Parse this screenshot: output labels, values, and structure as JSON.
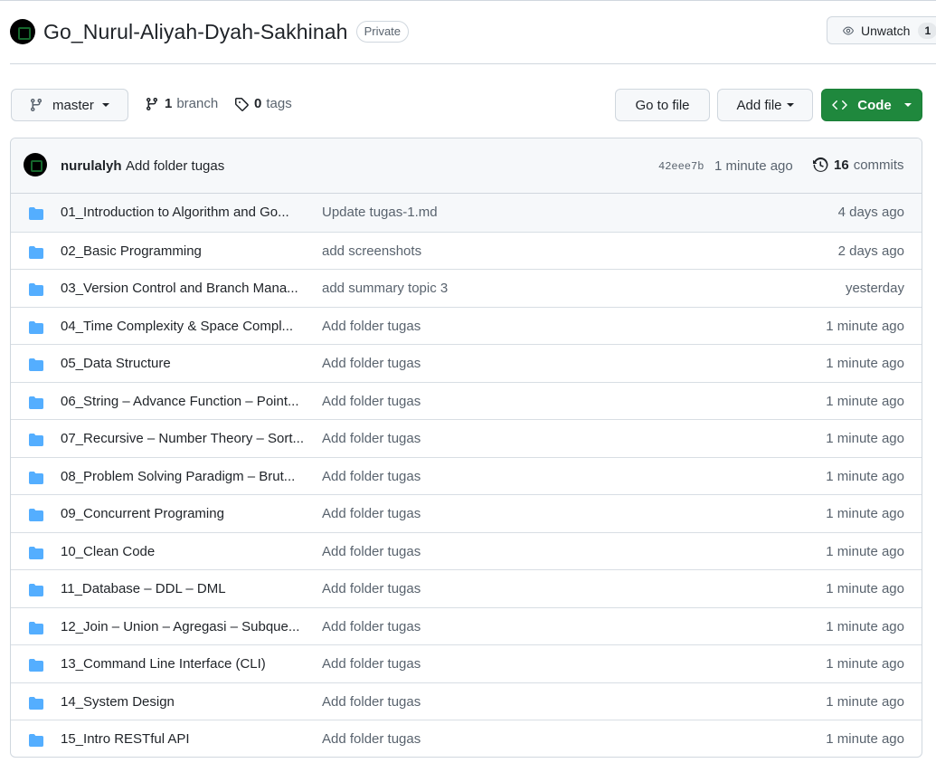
{
  "repo": {
    "name": "Go_Nurul-Aliyah-Dyah-Sakhinah",
    "visibility": "Private",
    "unwatch_label": "Unwatch",
    "watch_count": "1"
  },
  "toolbar": {
    "branch": "master",
    "branch_count": "1",
    "branch_label": "branch",
    "tag_count": "0",
    "tag_label": "tags",
    "go_to_file": "Go to file",
    "add_file": "Add file",
    "code": "Code"
  },
  "commit": {
    "author": "nurulalyh",
    "message": "Add folder tugas",
    "sha": "42eee7b",
    "time": "1 minute ago",
    "commit_count": "16",
    "commit_label": "commits"
  },
  "files": [
    {
      "name": "01_Introduction to Algorithm and Go...",
      "message": "Update tugas-1.md",
      "time": "4 days ago"
    },
    {
      "name": "02_Basic Programming",
      "message": "add screenshots",
      "time": "2 days ago"
    },
    {
      "name": "03_Version Control and Branch Mana...",
      "message": "add summary topic 3",
      "time": "yesterday"
    },
    {
      "name": "04_Time Complexity & Space Compl...",
      "message": "Add folder tugas",
      "time": "1 minute ago"
    },
    {
      "name": "05_Data Structure",
      "message": "Add folder tugas",
      "time": "1 minute ago"
    },
    {
      "name": "06_String – Advance Function – Point...",
      "message": "Add folder tugas",
      "time": "1 minute ago"
    },
    {
      "name": "07_Recursive – Number Theory – Sort...",
      "message": "Add folder tugas",
      "time": "1 minute ago"
    },
    {
      "name": "08_Problem Solving Paradigm – Brut...",
      "message": "Add folder tugas",
      "time": "1 minute ago"
    },
    {
      "name": "09_Concurrent Programing",
      "message": "Add folder tugas",
      "time": "1 minute ago"
    },
    {
      "name": "10_Clean Code",
      "message": "Add folder tugas",
      "time": "1 minute ago"
    },
    {
      "name": "11_Database – DDL – DML",
      "message": "Add folder tugas",
      "time": "1 minute ago"
    },
    {
      "name": "12_Join – Union – Agregasi – Subque...",
      "message": "Add folder tugas",
      "time": "1 minute ago"
    },
    {
      "name": "13_Command Line Interface (CLI)",
      "message": "Add folder tugas",
      "time": "1 minute ago"
    },
    {
      "name": "14_System Design",
      "message": "Add folder tugas",
      "time": "1 minute ago"
    },
    {
      "name": "15_Intro RESTful API",
      "message": "Add folder tugas",
      "time": "1 minute ago"
    }
  ],
  "icons": {
    "folder": "folder-icon",
    "branch": "git-branch-icon",
    "tag": "tag-icon",
    "eye": "eye-icon",
    "history": "history-icon",
    "code": "code-icon"
  },
  "colors": {
    "folder": "#54aeff",
    "code_button": "#1f883d",
    "border": "#d0d7de",
    "muted_text": "#59636e"
  }
}
